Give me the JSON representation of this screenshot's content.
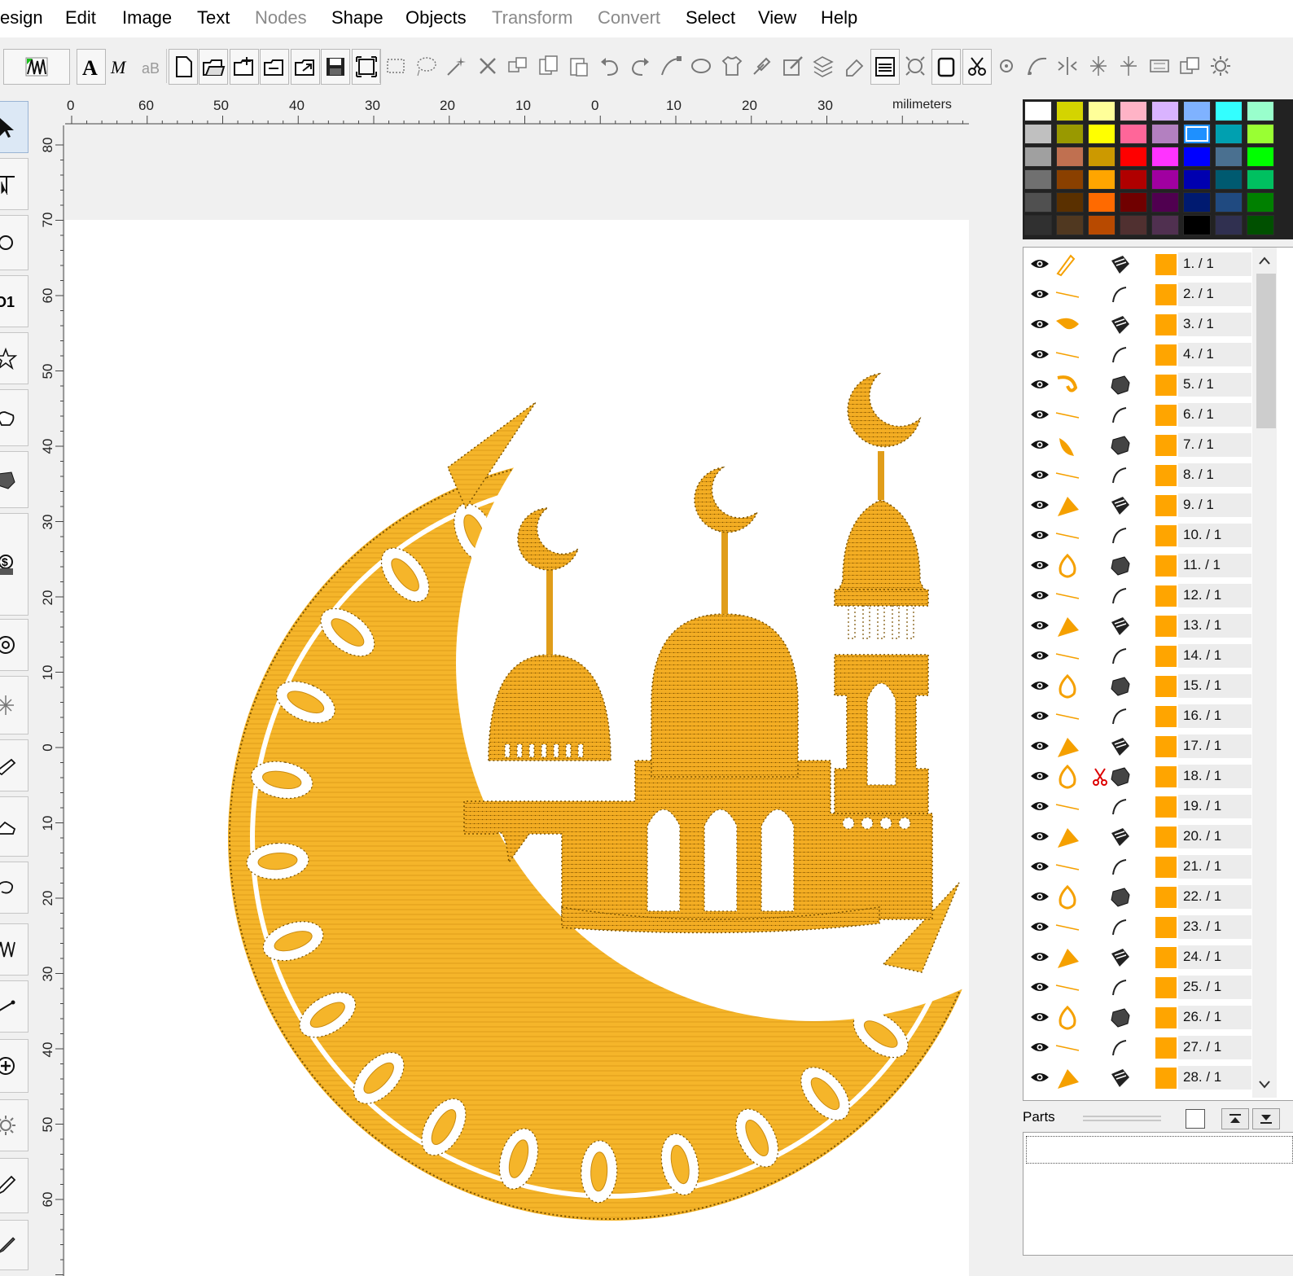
{
  "menu": {
    "items": [
      {
        "label": "esign",
        "enabled": true
      },
      {
        "label": "Edit",
        "enabled": true
      },
      {
        "label": "Image",
        "enabled": true
      },
      {
        "label": "Text",
        "enabled": true
      },
      {
        "label": "Nodes",
        "enabled": false
      },
      {
        "label": "Shape",
        "enabled": true
      },
      {
        "label": "Objects",
        "enabled": true
      },
      {
        "label": "Transform",
        "enabled": false
      },
      {
        "label": "Convert",
        "enabled": false
      },
      {
        "label": "Select",
        "enabled": true
      },
      {
        "label": "View",
        "enabled": true
      },
      {
        "label": "Help",
        "enabled": true
      }
    ]
  },
  "toolbar": {
    "buttons": [
      "stitch-mode-icon",
      "text-icon",
      "monogram-icon",
      "text-on-path-icon",
      "new-file-icon",
      "open-icon",
      "import-icon",
      "open-folder-icon",
      "export-icon",
      "save-icon",
      "fit-page-icon",
      "select-rect-icon",
      "select-lasso-icon",
      "select-magic-icon",
      "delete-icon",
      "group-icon",
      "copy-icon",
      "paste-icon",
      "undo-icon",
      "redo-icon",
      "nodes-icon",
      "shape-icon",
      "shirt-icon",
      "eyedropper-icon",
      "edit-icon",
      "stitch-order-icon",
      "eraser-icon",
      "fill-pattern-icon",
      "zoom-icon",
      "hoop-icon",
      "scissors-icon",
      "settings-icon",
      "curve-icon",
      "mirror-icon",
      "split-icon",
      "split-2-icon",
      "align-icon",
      "arrange-icon",
      "gear-icon"
    ]
  },
  "left_tools": [
    "pointer-icon",
    "node-edit-icon",
    "circle-icon",
    "numbering-icon",
    "star-icon",
    "hand-icon",
    "fill-icon",
    "dollar-icon",
    "rotate-icon",
    "split-icon",
    "knife-icon",
    "shoe-icon",
    "lasso-icon",
    "zigzag-icon",
    "line-icon",
    "plus-icon",
    "gear-icon",
    "pen-icon",
    "brush-icon"
  ],
  "ruler": {
    "unit": "milimeters",
    "horizontal_labels": [
      "0",
      "60",
      "50",
      "40",
      "30",
      "20",
      "10",
      "0",
      "10",
      "20",
      "30"
    ],
    "vertical_labels": [
      "80",
      "70",
      "60",
      "50",
      "40",
      "30",
      "20",
      "10",
      "0",
      "10",
      "20",
      "30",
      "40",
      "50",
      "60"
    ]
  },
  "palette": {
    "selected": "#1e90ff",
    "rows": [
      [
        "#ffffff",
        "#d4d400",
        "#ffff99",
        "#ffb3c6",
        "#d9b3ff",
        "#7fb2ff",
        "#33ffff",
        "#99ffcc"
      ],
      [
        "#c0c0c0",
        "#999900",
        "#ffff00",
        "#ff6699",
        "#b380c0",
        "#1e90ff",
        "#00a0b0",
        "#99ff33"
      ],
      [
        "#a0a0a0",
        "#c07050",
        "#cc9900",
        "#ff0000",
        "#ff33ff",
        "#0000ff",
        "#4a7090",
        "#00ff00"
      ],
      [
        "#707070",
        "#8a4000",
        "#ffa500",
        "#b00000",
        "#a000a0",
        "#0000b0",
        "#005a70",
        "#00c060"
      ],
      [
        "#505050",
        "#5a3000",
        "#ff6a00",
        "#700000",
        "#500050",
        "#001a70",
        "#204a80",
        "#008000"
      ],
      [
        "#303030",
        "#503820",
        "#b84a00",
        "#503030",
        "#503050",
        "#000000",
        "#303050",
        "#005000"
      ]
    ]
  },
  "objects": {
    "color": "#ffa500",
    "items": [
      {
        "label": "1.  / 1",
        "shape": "pen-shape-icon",
        "type": "fill-type-icon",
        "scissor": false
      },
      {
        "label": "2.  / 1",
        "shape": "line-shape-icon",
        "type": "run-type-icon",
        "scissor": false
      },
      {
        "label": "3.  / 1",
        "shape": "leaf-shape-icon",
        "type": "fill-type-icon",
        "scissor": false
      },
      {
        "label": "4.  / 1",
        "shape": "line-shape-icon",
        "type": "run-type-icon",
        "scissor": false
      },
      {
        "label": "5.  / 1",
        "shape": "curl-shape-icon",
        "type": "satin-type-icon",
        "scissor": false
      },
      {
        "label": "6.  / 1",
        "shape": "line-shape-icon",
        "type": "run-type-icon",
        "scissor": false
      },
      {
        "label": "7.  / 1",
        "shape": "petal-shape-icon",
        "type": "satin-type-icon",
        "scissor": false
      },
      {
        "label": "8.  / 1",
        "shape": "line-shape-icon",
        "type": "run-type-icon",
        "scissor": false
      },
      {
        "label": "9.  / 1",
        "shape": "triangle-shape-icon",
        "type": "fill-type-icon",
        "scissor": false
      },
      {
        "label": "10.  / 1",
        "shape": "line-shape-icon",
        "type": "run-type-icon",
        "scissor": false
      },
      {
        "label": "11.  / 1",
        "shape": "flame-shape-icon",
        "type": "satin-type-icon",
        "scissor": false
      },
      {
        "label": "12.  / 1",
        "shape": "line-shape-icon",
        "type": "run-type-icon",
        "scissor": false
      },
      {
        "label": "13.  / 1",
        "shape": "triangle-shape-icon",
        "type": "fill-type-icon",
        "scissor": false
      },
      {
        "label": "14.  / 1",
        "shape": "line-shape-icon",
        "type": "run-type-icon",
        "scissor": false
      },
      {
        "label": "15.  / 1",
        "shape": "flame-shape-icon",
        "type": "satin-type-icon",
        "scissor": false
      },
      {
        "label": "16.  / 1",
        "shape": "line-shape-icon",
        "type": "run-type-icon",
        "scissor": false
      },
      {
        "label": "17.  / 1",
        "shape": "triangle-shape-icon",
        "type": "fill-type-icon",
        "scissor": false
      },
      {
        "label": "18.  / 1",
        "shape": "flame-shape-icon",
        "type": "satin-type-icon",
        "scissor": true
      },
      {
        "label": "19.  / 1",
        "shape": "line-shape-icon",
        "type": "run-type-icon",
        "scissor": false
      },
      {
        "label": "20.  / 1",
        "shape": "triangle-shape-icon",
        "type": "fill-type-icon",
        "scissor": false
      },
      {
        "label": "21.  / 1",
        "shape": "line-shape-icon",
        "type": "run-type-icon",
        "scissor": false
      },
      {
        "label": "22.  / 1",
        "shape": "flame-shape-icon",
        "type": "satin-type-icon",
        "scissor": false
      },
      {
        "label": "23.  / 1",
        "shape": "line-shape-icon",
        "type": "run-type-icon",
        "scissor": false
      },
      {
        "label": "24.  / 1",
        "shape": "triangle-shape-icon",
        "type": "fill-type-icon",
        "scissor": false
      },
      {
        "label": "25.  / 1",
        "shape": "line-shape-icon",
        "type": "run-type-icon",
        "scissor": false
      },
      {
        "label": "26.  / 1",
        "shape": "flame-shape-icon",
        "type": "satin-type-icon",
        "scissor": false
      },
      {
        "label": "27.  / 1",
        "shape": "line-shape-icon",
        "type": "run-type-icon",
        "scissor": false
      },
      {
        "label": "28.  / 1",
        "shape": "triangle-shape-icon",
        "type": "fill-type-icon",
        "scissor": false
      }
    ]
  },
  "parts": {
    "label": "Parts"
  },
  "design": {
    "fill_color": "#f5b52a",
    "stroke_color": "#c98a10",
    "name": "crescent-mosque-design"
  }
}
